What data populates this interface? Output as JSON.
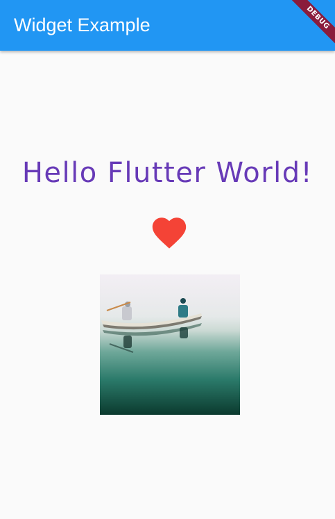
{
  "appbar": {
    "title": "Widget Example",
    "color": "#2196f3"
  },
  "debug_banner": {
    "label": "DEBUG",
    "color": "#8a1c3c"
  },
  "main": {
    "headline": "Hello Flutter World!",
    "headline_color": "#673ab7",
    "heart_icon": "heart-icon",
    "heart_color": "#f44336",
    "image": "canoe-photo"
  }
}
